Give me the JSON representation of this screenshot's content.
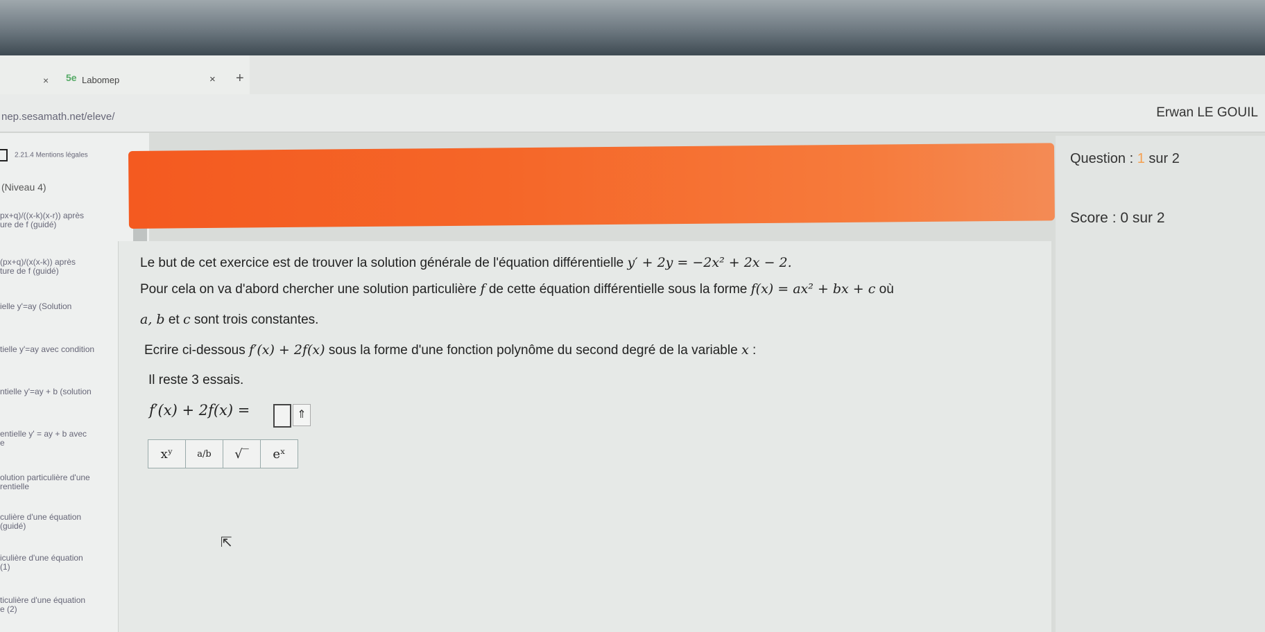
{
  "browser": {
    "tab_close_left": "×",
    "tab_logo": "5e",
    "tab_title": "Labomep",
    "tab_close": "×",
    "new_tab": "+",
    "url": "nep.sesamath.net/eleve/"
  },
  "header": {
    "user_name": "Erwan LE GOUIL",
    "legal_mentions": "2.21.4 Mentions légales",
    "question_prefix": "Question : ",
    "question_current": "1",
    "question_suffix": " sur 2",
    "score": "Score : 0 sur 2"
  },
  "sidebar": {
    "niveau": "(Niveau 4)",
    "items": [
      {
        "label": "px+q)/((x-k)(x-r)) après",
        "label2": "ure de f (guidé)",
        "sub": ""
      },
      {
        "label": "(px+q)/(x(x-k)) après",
        "label2": "ture de f (guidé)",
        "sub": ""
      },
      {
        "label": "ielle y'=ay (Solution",
        "label2": "",
        "sub": ""
      },
      {
        "label": "tielle y'=ay avec condition",
        "label2": "",
        "sub": ""
      },
      {
        "label": "ntielle y'=ay + b (solution",
        "label2": "",
        "sub": ""
      },
      {
        "label": "entielle y' = ay + b avec",
        "label2": "e",
        "sub": ""
      },
      {
        "label": "olution particulière d'une",
        "label2": "rentielle",
        "sub": ""
      },
      {
        "label": "culière d'une équation",
        "label2": "(guidé)",
        "sub": ""
      },
      {
        "label": "iculière d'une équation",
        "label2": "(1)",
        "sub": ""
      },
      {
        "label": "ticulière d'une équation",
        "label2": "e (2)",
        "sub": ""
      }
    ]
  },
  "exercise": {
    "line1_text": "Le but de cet exercice est de trouver la solution générale de l'équation différentielle ",
    "line1_math": "y′ + 2y = −2x² + 2x − 2.",
    "line2_text": "Pour cela on va d'abord chercher une solution particulière ",
    "line2_f": "f",
    "line2_text2": " de cette équation différentielle sous la forme ",
    "line2_math": "f(x) = ax² + bx + c",
    "line2_end": " où",
    "line3_math": "a, b",
    "line3_et": " et ",
    "line3_c": "c",
    "line3_text": " sont trois constantes.",
    "line4_text": "Ecrire ci-dessous ",
    "line4_math": "f′(x) + 2f(x)",
    "line4_text2": " sous la forme d'une fonction polynôme du second degré de la variable ",
    "line4_x": "x",
    "line4_end": " :",
    "tries": "Il reste 3 essais.",
    "answer_label": "f′(x) + 2f(x) =",
    "up_button": "⇑"
  },
  "toolbar": {
    "power": "xʸ",
    "fraction": "a/b",
    "sqrt": "√‾",
    "exp": "eˣ"
  },
  "colors": {
    "banner": "#f45a20",
    "accent": "#f5a050"
  }
}
